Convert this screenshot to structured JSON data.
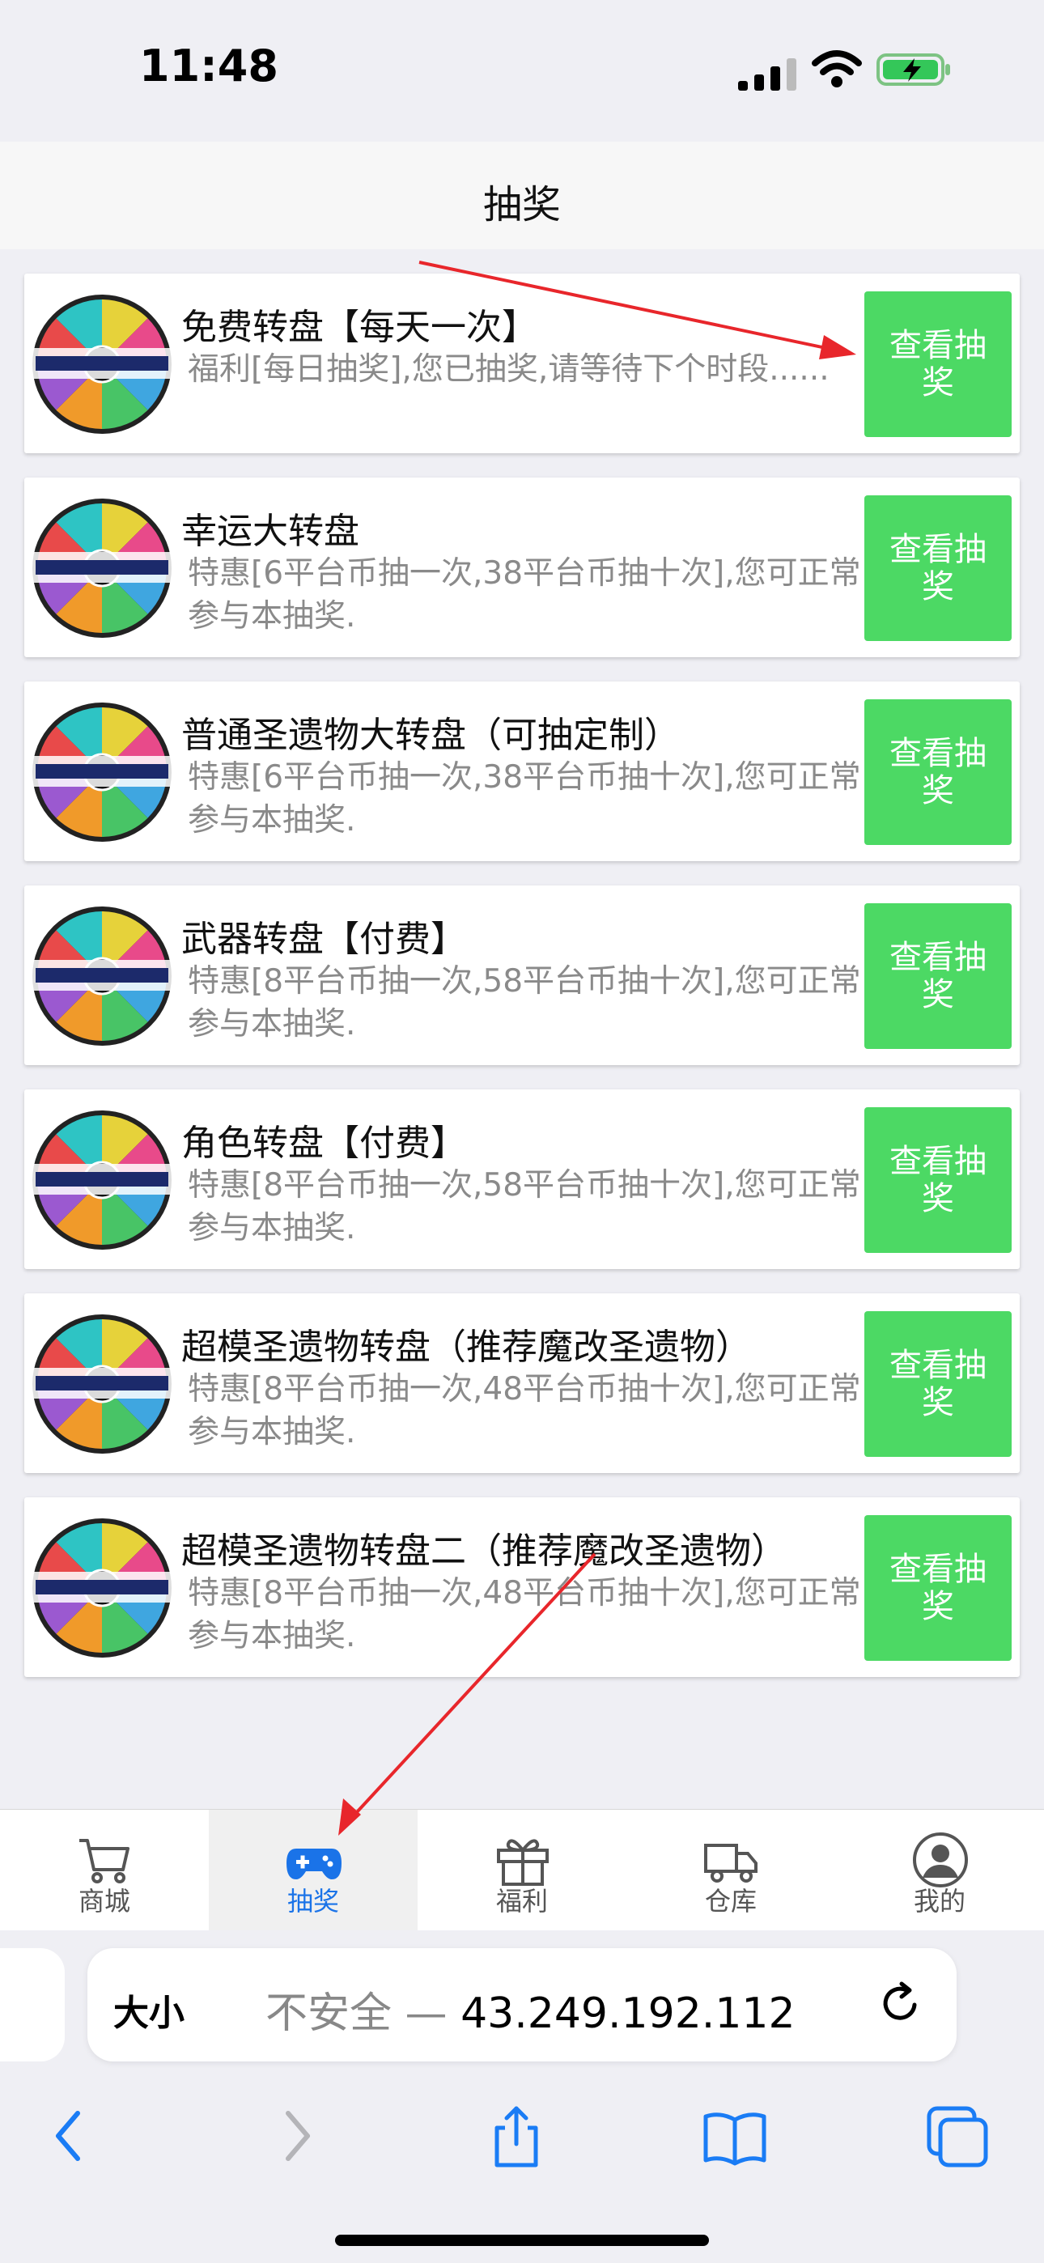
{
  "status_bar": {
    "time": "11:48"
  },
  "nav": {
    "title": "抽奖"
  },
  "colors": {
    "button_green": "#4cd964",
    "tab_active_blue": "#1a73e8",
    "annotation_red": "#e8262b"
  },
  "lottery_items": [
    {
      "title": "免费转盘【每天一次】",
      "desc": "福利[每日抽奖],您已抽奖,请等待下个时段......",
      "button": "查看抽奖"
    },
    {
      "title": "幸运大转盘",
      "desc": "特惠[6平台币抽一次,38平台币抽十次],您可正常参与本抽奖.",
      "button": "查看抽奖"
    },
    {
      "title": "普通圣遗物大转盘（可抽定制）",
      "desc": "特惠[6平台币抽一次,38平台币抽十次],您可正常参与本抽奖.",
      "button": "查看抽奖"
    },
    {
      "title": "武器转盘【付费】",
      "desc": "特惠[8平台币抽一次,58平台币抽十次],您可正常参与本抽奖.",
      "button": "查看抽奖"
    },
    {
      "title": "角色转盘【付费】",
      "desc": "特惠[8平台币抽一次,58平台币抽十次],您可正常参与本抽奖.",
      "button": "查看抽奖"
    },
    {
      "title": "超模圣遗物转盘（推荐魔改圣遗物）",
      "desc": "特惠[8平台币抽一次,48平台币抽十次],您可正常参与本抽奖.",
      "button": "查看抽奖"
    },
    {
      "title": "超模圣遗物转盘二（推荐魔改圣遗物）",
      "desc": "特惠[8平台币抽一次,48平台币抽十次],您可正常参与本抽奖.",
      "button": "查看抽奖"
    }
  ],
  "tab_bar": {
    "tabs": [
      {
        "label": "商城",
        "icon": "cart-icon"
      },
      {
        "label": "抽奖",
        "icon": "gamepad-icon"
      },
      {
        "label": "福利",
        "icon": "gift-icon"
      },
      {
        "label": "仓库",
        "icon": "truck-icon"
      },
      {
        "label": "我的",
        "icon": "user-icon"
      }
    ],
    "active_index": 1
  },
  "browser": {
    "text_size_label": "大小",
    "insecure_label": "不安全 —",
    "address": "43.249.192.112"
  }
}
